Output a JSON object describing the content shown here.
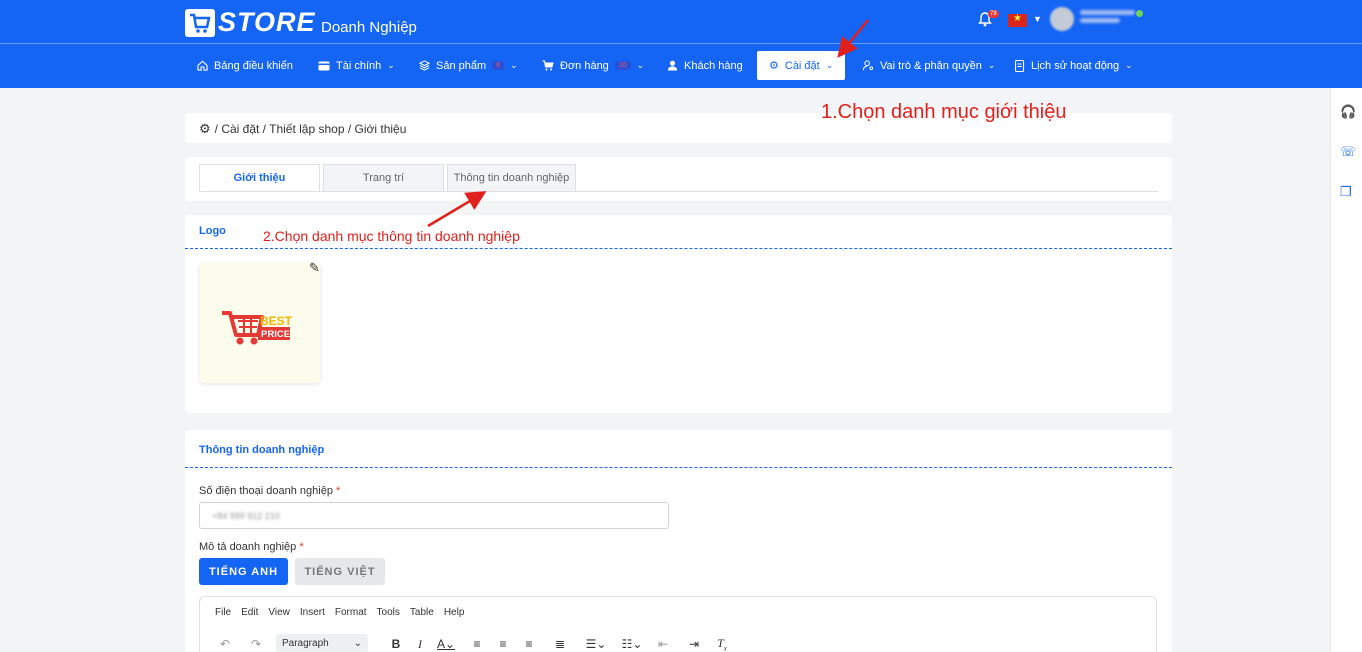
{
  "header": {
    "logo_text": "STORE",
    "subtitle": "Doanh Nghiệp",
    "notif_count": "78"
  },
  "nav": {
    "dashboard": "Bảng điều khiển",
    "finance": "Tài chính",
    "products": "Sản phẩm",
    "products_badge": "8",
    "orders": "Đơn hàng",
    "orders_badge": "10",
    "customers": "Khách hàng",
    "settings": "Cài đặt",
    "roles": "Vai trò & phân quyền",
    "history": "Lịch sử hoạt động"
  },
  "annotations": {
    "step1": "1.Chọn danh mục giới thiệu",
    "step2": "2.Chọn danh mục thông tin doanh nghiệp"
  },
  "breadcrumb": "/ Cài đặt / Thiết lập shop / Giới thiệu",
  "tabs": [
    "Giới thiệu",
    "Trang trí",
    "Thông tin doanh nghiệp"
  ],
  "logo_section": {
    "title": "Logo",
    "image_line1": "BEST",
    "image_line2": "PRICE"
  },
  "business_section": {
    "title": "Thông tin doanh nghiệp",
    "phone_label": "Số điện thoại doanh nghiệp",
    "phone_value": "+84 999 912 210",
    "desc_label": "Mô tả doanh nghiệp",
    "required_mark": "*",
    "lang_en": "TIẾNG ANH",
    "lang_vi": "TIẾNG VIỆT"
  },
  "editor": {
    "menu": [
      "File",
      "Edit",
      "View",
      "Insert",
      "Format",
      "Tools",
      "Table",
      "Help"
    ],
    "block_format": "Paragraph"
  },
  "colors": {
    "primary": "#1565f5",
    "annotation": "#e0201c"
  }
}
